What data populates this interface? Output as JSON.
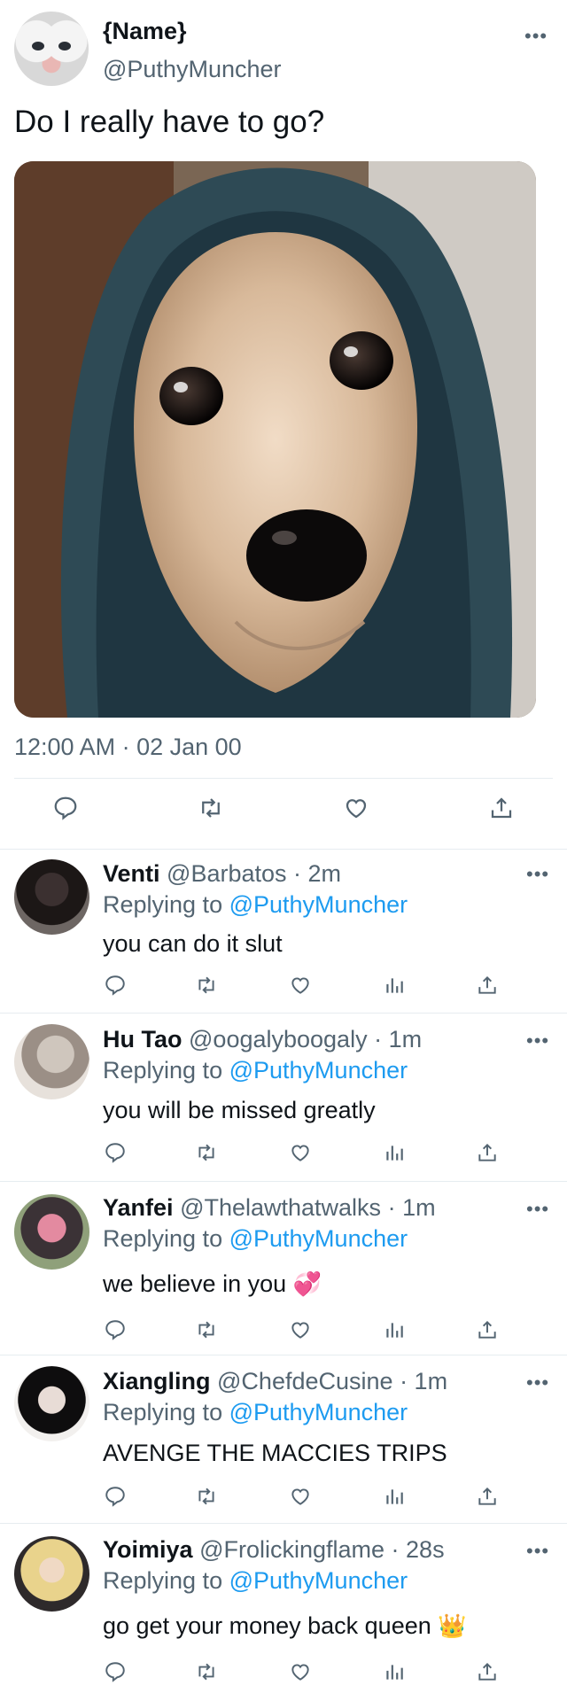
{
  "tweet": {
    "name": "{Name}",
    "handle": "@PuthyMuncher",
    "text": "Do I really have to go?",
    "timestamp": "12:00 AM · 02 Jan 00",
    "more_icon": "more-icon",
    "actions": [
      "reply-icon",
      "retweet-icon",
      "like-icon",
      "share-icon"
    ]
  },
  "replies": [
    {
      "name": "Venti",
      "handle": "@Barbatos",
      "time": "· 2m",
      "replying_label": "Replying to",
      "replying_to": "@PuthyMuncher",
      "text": "you can do it slut",
      "emoji": ""
    },
    {
      "name": "Hu Tao",
      "handle": "@oogalyboogaly",
      "time": "· 1m",
      "replying_label": "Replying to",
      "replying_to": "@PuthyMuncher",
      "text": "you will be missed greatly",
      "emoji": ""
    },
    {
      "name": "Yanfei",
      "handle": "@Thelawthatwalks",
      "time": "· 1m",
      "replying_label": "Replying to",
      "replying_to": "@PuthyMuncher",
      "text": "we believe in you",
      "emoji": "💞"
    },
    {
      "name": "Xiangling",
      "handle": "@ChefdeCusine",
      "time": "· 1m",
      "replying_label": "Replying to",
      "replying_to": "@PuthyMuncher",
      "text": "AVENGE THE MACCIES TRIPS",
      "emoji": ""
    },
    {
      "name": "Yoimiya",
      "handle": "@Frolickingflame",
      "time": "· 28s",
      "replying_label": "Replying to",
      "replying_to": "@PuthyMuncher",
      "text": "go get your money back queen",
      "emoji": "👑"
    }
  ],
  "colors": {
    "text": "#0f1419",
    "secondary": "#536471",
    "accent": "#1d9bf0",
    "divider": "#e6ecf0"
  }
}
